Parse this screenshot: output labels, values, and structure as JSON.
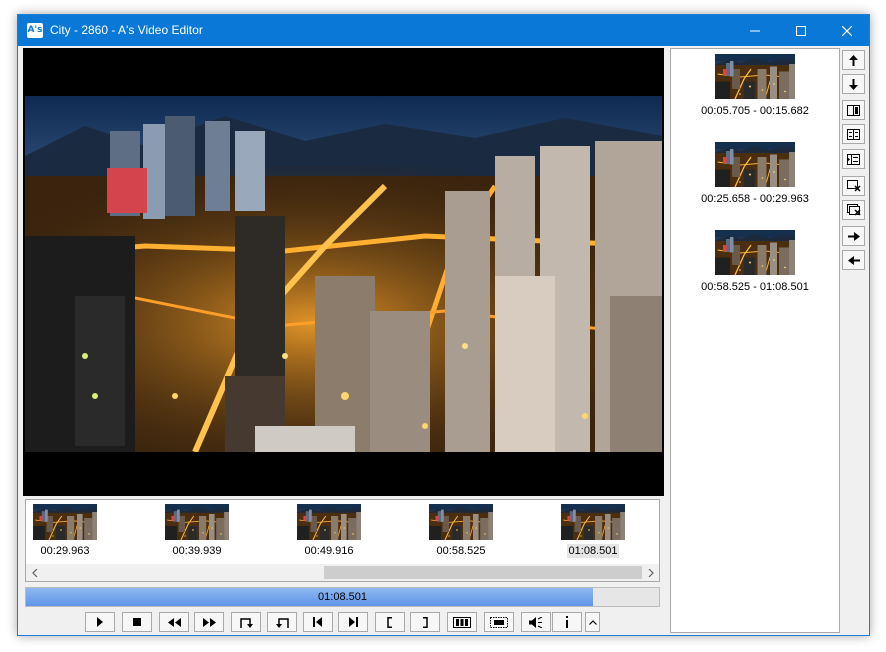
{
  "window": {
    "title": "City - 2860 - A's Video Editor",
    "app_icon_text": "A's",
    "icons": [
      "minimize-icon",
      "maximize-icon",
      "close-icon"
    ]
  },
  "timeline": {
    "items": [
      {
        "time": "00:29.963",
        "selected": false
      },
      {
        "time": "00:39.939",
        "selected": false
      },
      {
        "time": "00:49.916",
        "selected": false
      },
      {
        "time": "00:58.525",
        "selected": false
      },
      {
        "time": "01:08.501",
        "selected": true
      }
    ]
  },
  "playback": {
    "current_time": "01:08.501",
    "progress_fraction": 0.895
  },
  "controls": [
    {
      "name": "play-icon"
    },
    {
      "name": "stop-icon"
    },
    {
      "name": "rewind-icon"
    },
    {
      "name": "fast-forward-icon"
    },
    {
      "name": "set-start-icon"
    },
    {
      "name": "set-end-icon"
    },
    {
      "name": "previous-frame-icon"
    },
    {
      "name": "next-frame-icon"
    },
    {
      "name": "mark-in-icon"
    },
    {
      "name": "mark-out-icon"
    },
    {
      "name": "add-segment-icon"
    },
    {
      "name": "snapshot-icon"
    },
    {
      "name": "volume-icon"
    },
    {
      "name": "info-icon"
    },
    {
      "name": "expand-icon"
    }
  ],
  "segments": [
    {
      "range": "00:05.705 - 00:15.682"
    },
    {
      "range": "00:25.658 - 00:29.963"
    },
    {
      "range": "00:58.525 - 01:08.501"
    }
  ],
  "side_tools": [
    {
      "name": "move-up-icon"
    },
    {
      "name": "move-down-icon"
    },
    {
      "name": "split-left-icon"
    },
    {
      "name": "split-columns-icon"
    },
    {
      "name": "split-right-icon"
    },
    {
      "name": "remove-segment-icon"
    },
    {
      "name": "remove-all-icon"
    },
    {
      "name": "export-icon"
    },
    {
      "name": "import-icon"
    }
  ],
  "colors": {
    "titlebar": "#0a78d7",
    "progress": "#6a9fea",
    "city_lights": "#f5a623"
  }
}
